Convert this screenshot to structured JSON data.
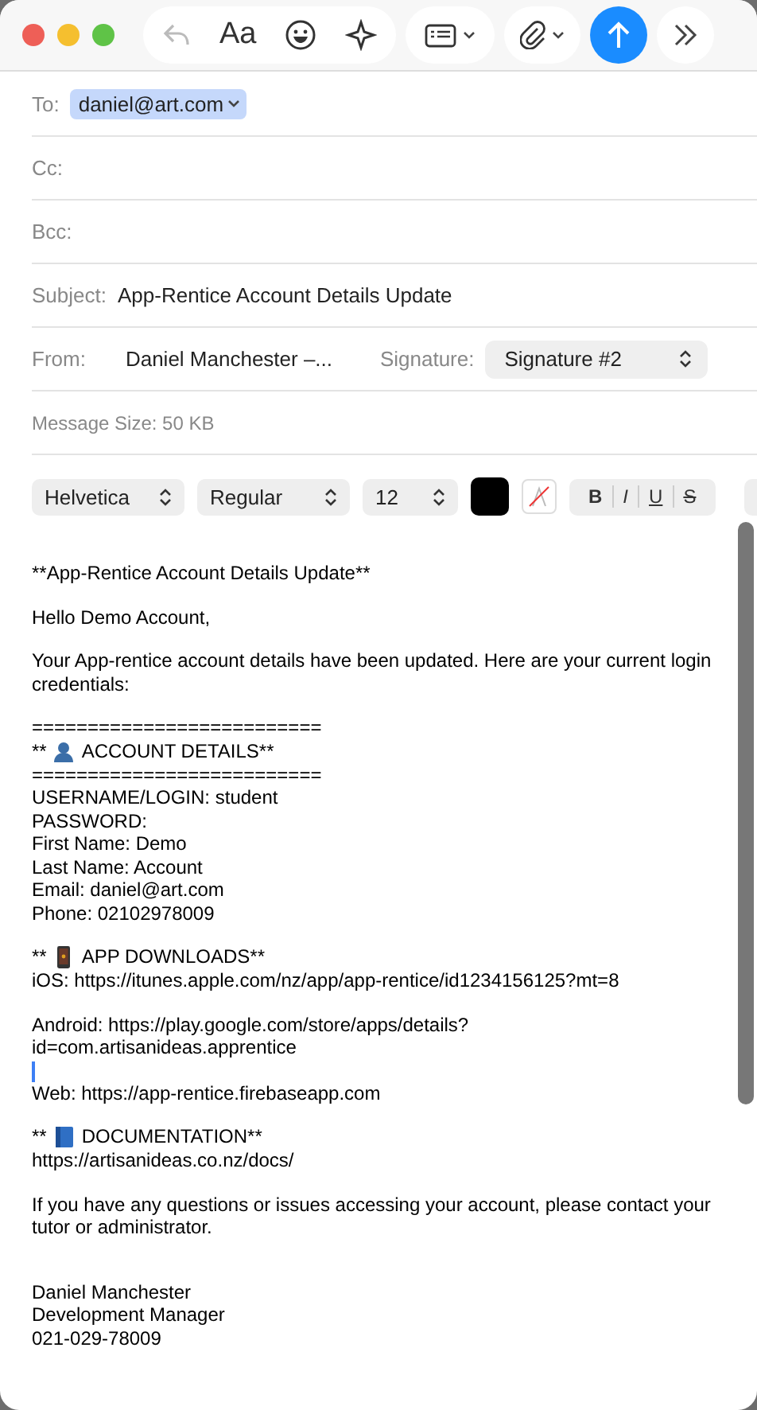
{
  "toolbar": {
    "reply_disabled": true,
    "format_label": "Aa"
  },
  "headers": [
    {
      "kind": "recipients",
      "label": "To:",
      "tokens": [
        "daniel@art.com"
      ]
    },
    {
      "kind": "empty",
      "label": "Cc:"
    },
    {
      "kind": "empty",
      "label": "Bcc:"
    },
    {
      "kind": "text",
      "label": "Subject:",
      "value": "App-Rentice Account Details Update"
    },
    {
      "kind": "from",
      "label": "From:",
      "value": "Daniel Manchester –...",
      "signature_label": "Signature:",
      "signature": "Signature #2"
    },
    {
      "kind": "info",
      "label": "Message Size:",
      "value": "50 KB"
    }
  ],
  "format_bar": {
    "font": "Helvetica",
    "style": "Regular",
    "size": "12",
    "color": "#000000",
    "styles": [
      "B",
      "I",
      "U",
      "S"
    ]
  },
  "body": [
    {
      "kind": "text",
      "text": "**App-Rentice Account Details Update**"
    },
    {
      "kind": "blank"
    },
    {
      "kind": "text",
      "text": "Hello Demo Account,"
    },
    {
      "kind": "blank"
    },
    {
      "kind": "text",
      "text": "Your App-rentice account details have been updated. Here are your current login credentials:"
    },
    {
      "kind": "blank"
    },
    {
      "kind": "text",
      "text": "=========================="
    },
    {
      "kind": "heading",
      "prefix": "**",
      "text": "ACCOUNT DETAILS**"
    },
    {
      "kind": "text",
      "text": "=========================="
    },
    {
      "kind": "text",
      "text": "USERNAME/LOGIN: student"
    },
    {
      "kind": "text",
      "text": "PASSWORD:"
    },
    {
      "kind": "text",
      "text": "First Name: Demo"
    },
    {
      "kind": "text",
      "text": "Last Name: Account"
    },
    {
      "kind": "text",
      "text": "Email: daniel@art.com"
    },
    {
      "kind": "text",
      "text": "Phone: 02102978009"
    },
    {
      "kind": "blank"
    },
    {
      "kind": "heading",
      "prefix": "**",
      "text": "APP DOWNLOADS**"
    },
    {
      "kind": "text",
      "text": "iOS: https://itunes.apple.com/nz/app/app-rentice/id1234156125?mt=8"
    },
    {
      "kind": "blank"
    },
    {
      "kind": "text",
      "text": "Android: https://play.google.com/store/apps/details?"
    },
    {
      "kind": "text",
      "text": "id=com.artisanideas.apprentice"
    },
    {
      "kind": "caret"
    },
    {
      "kind": "text",
      "text": "Web: https://app-rentice.firebaseapp.com"
    },
    {
      "kind": "blank"
    },
    {
      "kind": "heading",
      "prefix": "**",
      "text": "DOCUMENTATION**"
    },
    {
      "kind": "text",
      "text": "https://artisanideas.co.nz/docs/"
    },
    {
      "kind": "blank"
    },
    {
      "kind": "text",
      "text": "If you have any questions or issues accessing your account, please contact your tutor or administrator."
    },
    {
      "kind": "blank"
    },
    {
      "kind": "blank"
    },
    {
      "kind": "text",
      "text": "Daniel Manchester"
    },
    {
      "kind": "text",
      "text": "Development Manager"
    },
    {
      "kind": "text",
      "text": "021-029-78009"
    }
  ]
}
